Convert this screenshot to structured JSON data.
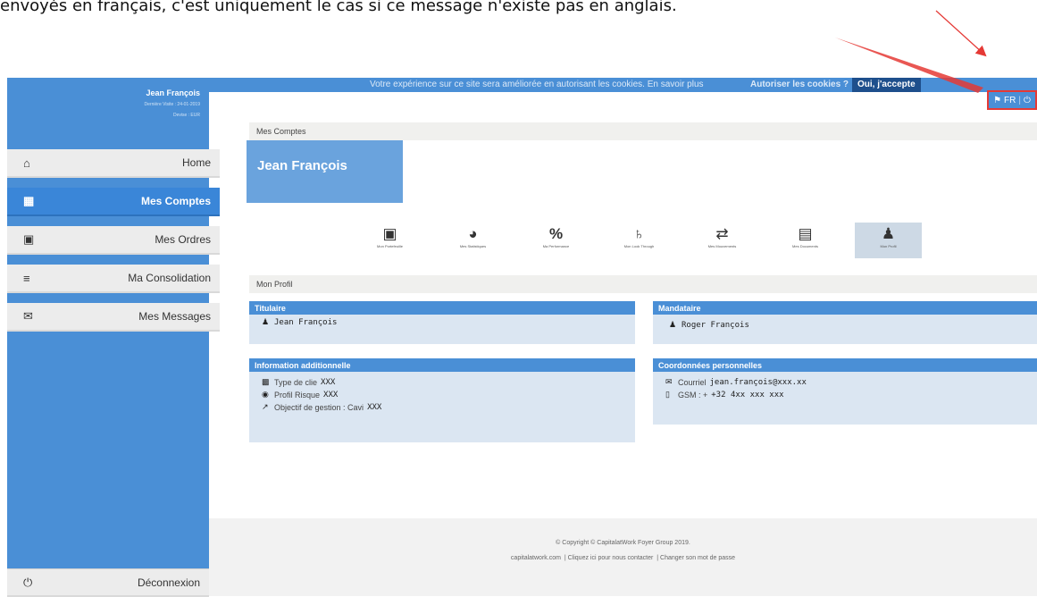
{
  "caption": "envoyés en français, c'est uniquement le cas si ce message n'existe pas en anglais.",
  "colors": {
    "brand": "#4a8fd6",
    "active_nav": "#3a86d8",
    "annotation": "#e53935"
  },
  "sidebar": {
    "user_name": "Jean François",
    "last_visit": "Dernière Visite : 24-01-2019",
    "currency": "Devise : EUR",
    "items": [
      {
        "label": "Home",
        "icon": "home-icon"
      },
      {
        "label": "Mes Comptes",
        "icon": "grid-icon"
      },
      {
        "label": "Mes Ordres",
        "icon": "money-icon"
      },
      {
        "label": "Ma Consolidation",
        "icon": "list-icon"
      },
      {
        "label": "Mes Messages",
        "icon": "envelope-icon"
      }
    ],
    "logout": "Déconnexion"
  },
  "topbar": {
    "cookie_text": "Votre expérience sur ce site sera améliorée en autorisant les cookies. En savoir plus",
    "cookie_question": "Autoriser les cookies ?",
    "cookie_accept": "Oui, j'accepte",
    "language": "FR"
  },
  "main": {
    "section_title": "Mes Comptes",
    "account_name": "Jean François",
    "tools": [
      {
        "label": "Mon Portefeuille",
        "icon": "briefcase-icon"
      },
      {
        "label": "Mes Statistiques",
        "icon": "pie-chart-icon"
      },
      {
        "label": "Ma Performance",
        "icon": "percent-icon"
      },
      {
        "label": "Mon Look Through",
        "icon": "sitemap-icon"
      },
      {
        "label": "Mes Mouvements",
        "icon": "exchange-icon"
      },
      {
        "label": "Mes Documents",
        "icon": "document-icon"
      },
      {
        "label": "Mon Profil",
        "icon": "user-icon"
      }
    ],
    "profile_title": "Mon Profil",
    "titulaire": {
      "head": "Titulaire",
      "name": "Jean François"
    },
    "mandataire": {
      "head": "Mandataire",
      "name": "Roger François"
    },
    "info": {
      "head": "Information additionnelle",
      "type_label": "Type de clie",
      "type_value": "XXX",
      "risk_label": "Profil Risque",
      "risk_value": "XXX",
      "goal_label": "Objectif de gestion : Cavi",
      "goal_value": "XXX"
    },
    "contact": {
      "head": "Coordonnées personnelles",
      "mail_label": "Courriel",
      "mail_value": "jean.françois@xxx.xx",
      "gsm_label": "GSM : +",
      "gsm_value": "+32 4xx xxx xxx"
    }
  },
  "footer": {
    "copyright": "© Copyright © CapitalatWork Foyer Group 2019.",
    "link_site": "capitalatwork.com",
    "link_contact": "Cliquez ici pour nous contacter",
    "link_password": "Changer son mot de passe"
  }
}
